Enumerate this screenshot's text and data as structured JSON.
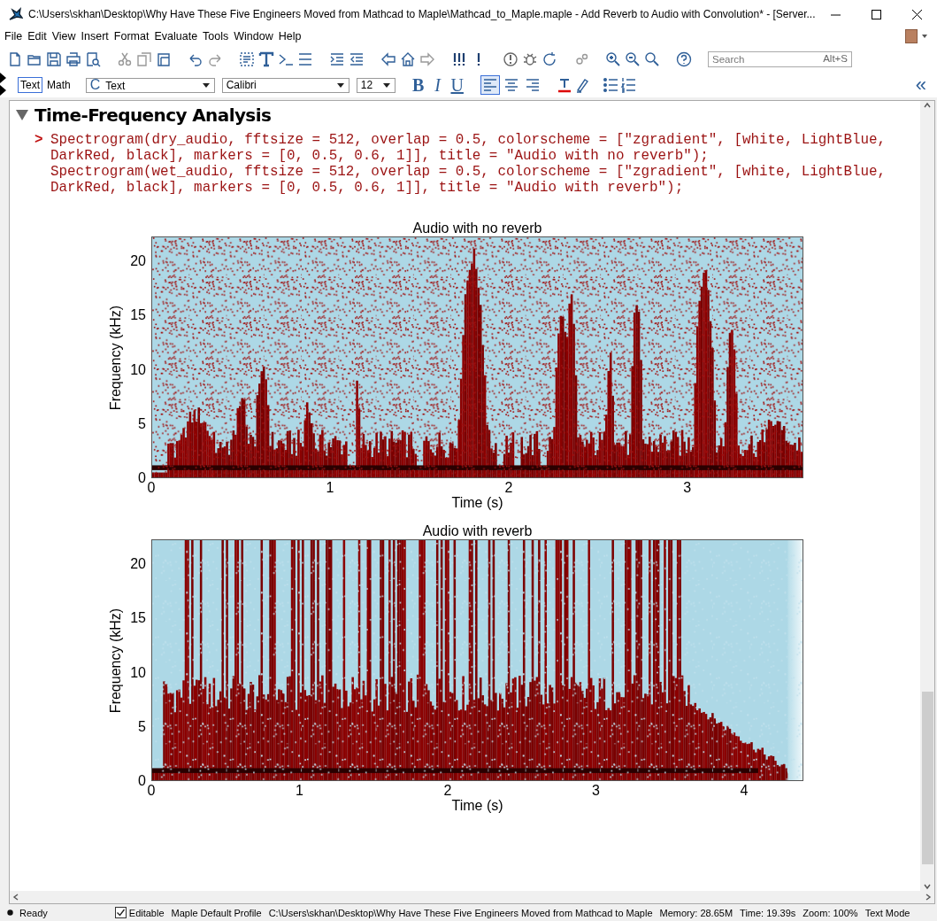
{
  "window": {
    "title": "C:\\Users\\skhan\\Desktop\\Why Have These Five Engineers Moved from Mathcad to Maple\\Mathcad_to_Maple.maple - Add Reverb to Audio with Convolution* - [Server..."
  },
  "menu": [
    "File",
    "Edit",
    "View",
    "Insert",
    "Format",
    "Evaluate",
    "Tools",
    "Window",
    "Help"
  ],
  "toolbar": {
    "search": {
      "placeholder": "Search",
      "shortcut": "Alt+S"
    }
  },
  "format_bar": {
    "modes": [
      {
        "label": "Text",
        "selected": true
      },
      {
        "label": "Math",
        "selected": false
      }
    ],
    "style": {
      "glyph": "C",
      "value": "Text"
    },
    "font": "Calibri",
    "size": "12",
    "emphasis": [
      {
        "kind": "bold",
        "label": "B"
      },
      {
        "kind": "italic",
        "label": "I"
      },
      {
        "kind": "underline",
        "label": "U"
      }
    ],
    "align": [
      {
        "kind": "left",
        "selected": true
      },
      {
        "kind": "center",
        "selected": false
      },
      {
        "kind": "right",
        "selected": false
      }
    ],
    "collapse": "«"
  },
  "section": {
    "title": "Time-Frequency Analysis",
    "expanded": true,
    "prompt": ">",
    "code": [
      "Spectrogram(dry_audio, fftsize = 512, overlap = 0.5, colorscheme = [\"zgradient\", [white, LightBlue,",
      "DarkRed, black], markers = [0, 0.5, 0.6, 1]], title = \"Audio with no reverb\");",
      "Spectrogram(wet_audio, fftsize = 512, overlap = 0.5, colorscheme = [\"zgradient\", [white, LightBlue,",
      "DarkRed, black], markers = [0, 0.5, 0.6, 1]], title = \"Audio with reverb\");"
    ]
  },
  "plots": [
    {
      "title": "Audio with no reverb",
      "xlabel": "Time (s)",
      "ylabel": "Frequency (kHz)",
      "xticks": [
        "0",
        "1",
        "2",
        "3"
      ],
      "yticks": [
        "20",
        "15",
        "10",
        "5",
        "0"
      ]
    },
    {
      "title": "Audio with reverb",
      "xlabel": "Time (s)",
      "ylabel": "Frequency (kHz)",
      "xticks": [
        "0",
        "1",
        "2",
        "3",
        "4"
      ],
      "yticks": [
        "20",
        "15",
        "10",
        "5",
        "0"
      ]
    }
  ],
  "status_bar": {
    "state": "Ready",
    "editable": {
      "label": "Editable",
      "checked": true
    },
    "profile": "Maple Default Profile",
    "path": "C:\\Users\\skhan\\Desktop\\Why Have These Five Engineers Moved from Mathcad to Maple",
    "memory": "Memory: 28.65M",
    "time": "Time: 19.39s",
    "zoom": "Zoom: 100%",
    "mode": "Text Mode"
  }
}
